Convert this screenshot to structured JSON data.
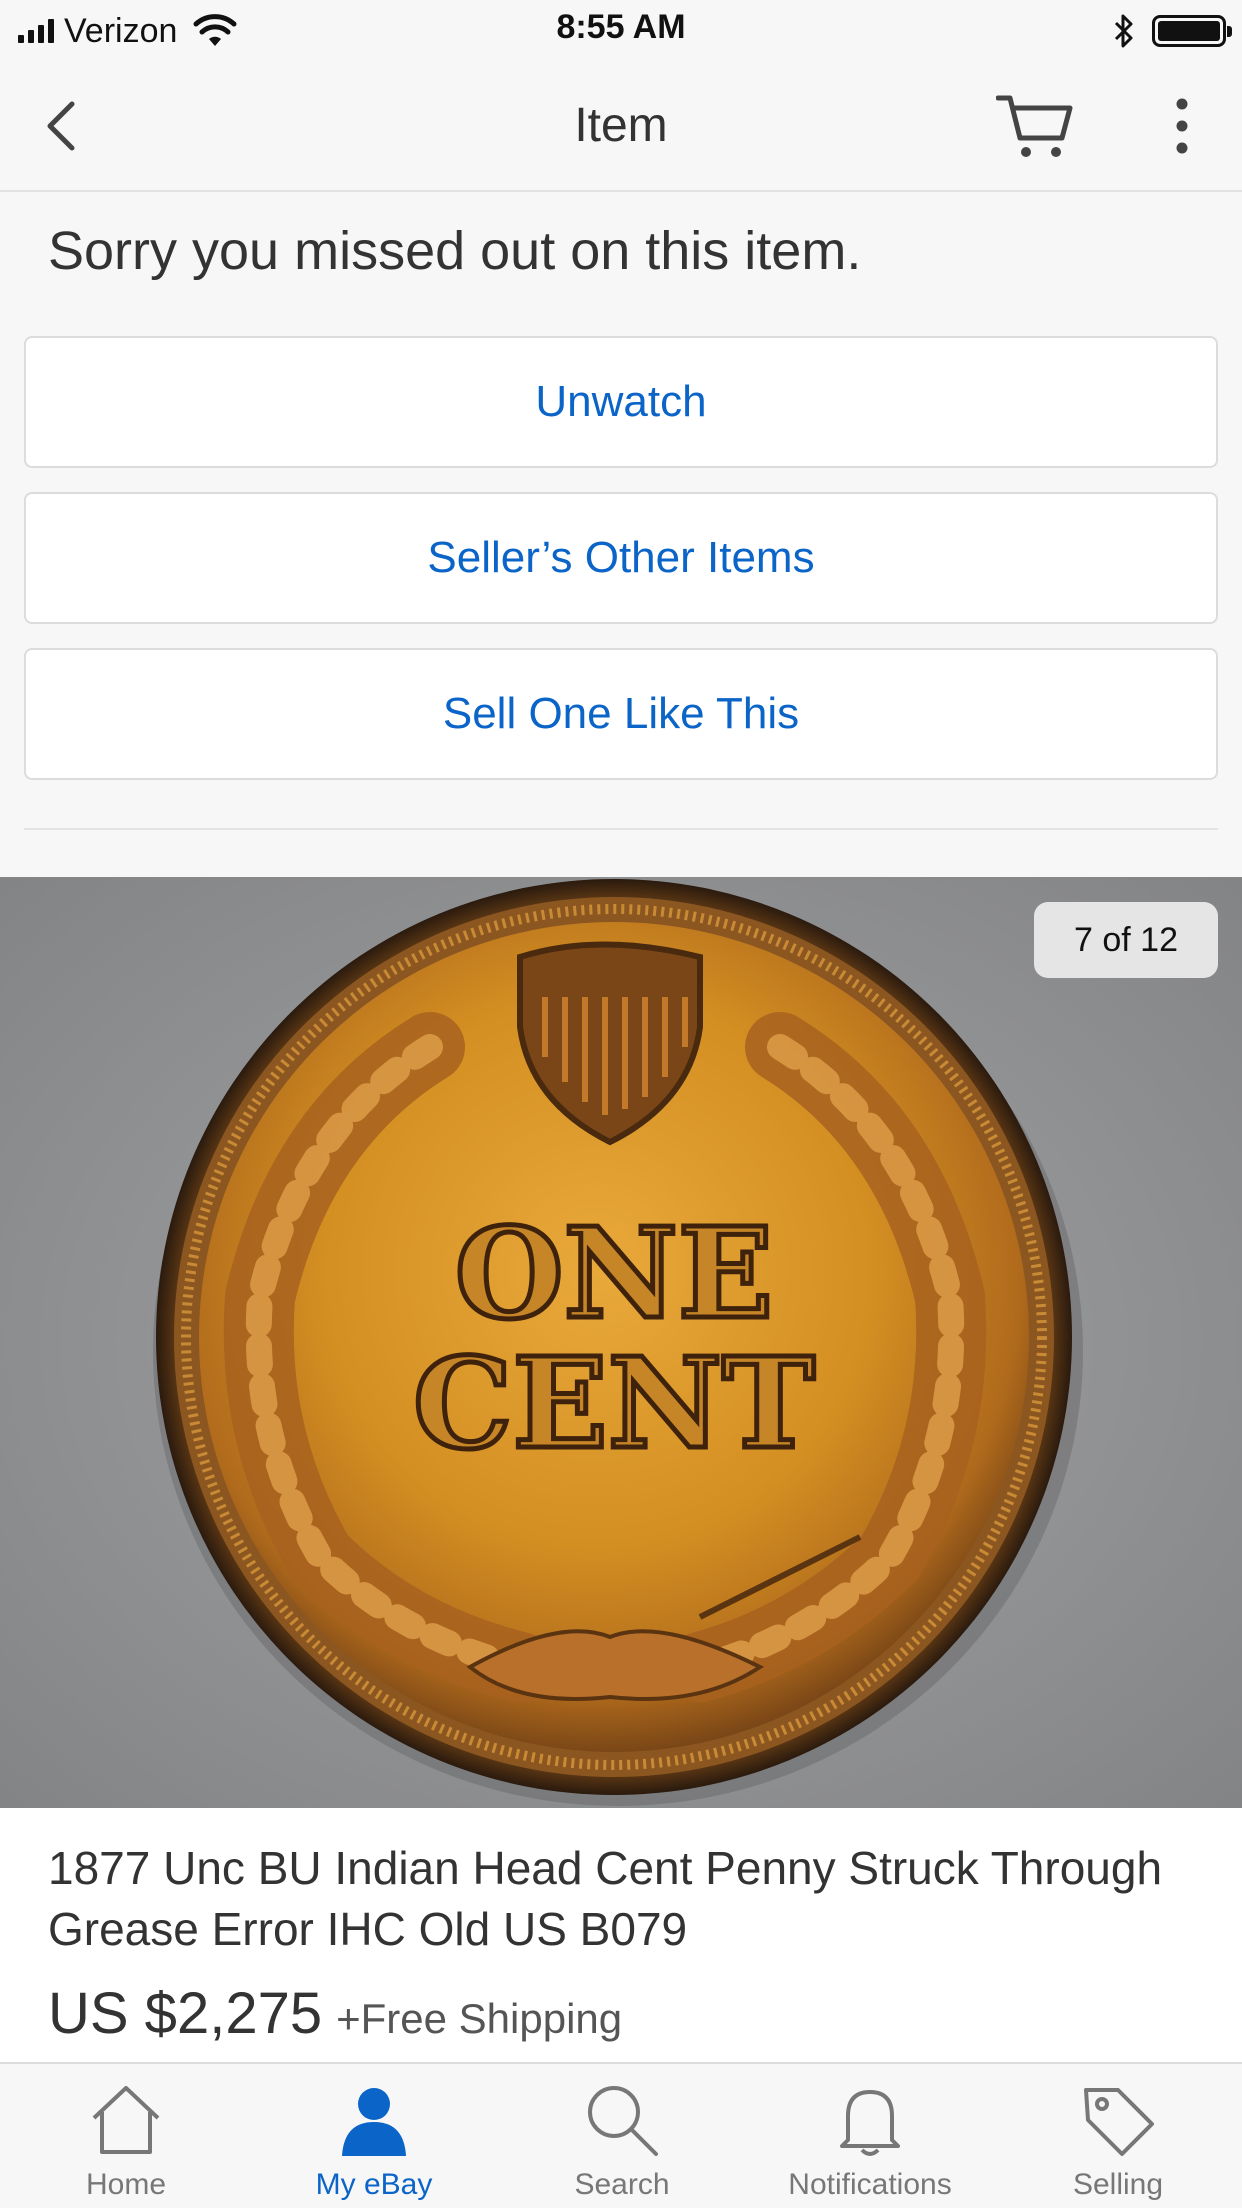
{
  "status_bar": {
    "carrier": "Verizon",
    "time": "8:55 AM"
  },
  "nav": {
    "title": "Item"
  },
  "message": "Sorry you missed out on this item.",
  "actions": {
    "unwatch": "Unwatch",
    "sellers_other_items": "Seller’s Other Items",
    "sell_one_like_this": "Sell One Like This"
  },
  "gallery": {
    "counter": "7 of 12",
    "current_image": 7,
    "total_images": 12,
    "coin_text_line1": "ONE",
    "coin_text_line2": "CENT"
  },
  "item": {
    "title": "1877 Unc BU Indian Head Cent Penny Struck Through Grease Error IHC Old US B079",
    "price": "US $2,275",
    "shipping": "+Free Shipping"
  },
  "tabs": [
    {
      "label": "Home",
      "icon": "home-icon"
    },
    {
      "label": "My eBay",
      "icon": "person-icon"
    },
    {
      "label": "Search",
      "icon": "search-icon"
    },
    {
      "label": "Notifications",
      "icon": "bell-icon"
    },
    {
      "label": "Selling",
      "icon": "tag-icon"
    }
  ],
  "colors": {
    "accent": "#0b64c8",
    "background": "#f7f7f7",
    "coin": "#c98a1e"
  }
}
